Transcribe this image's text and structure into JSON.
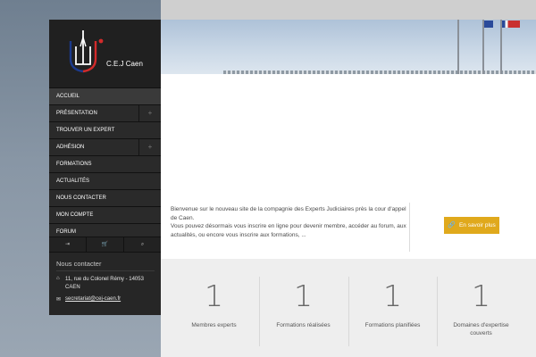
{
  "brand": {
    "name": "C.E.J Caen",
    "colors": {
      "blue": "#1b3a8c",
      "red": "#d22b2b",
      "white": "#ffffff"
    }
  },
  "nav": {
    "items": [
      {
        "label": "ACCUEIL",
        "active": true,
        "expandable": false
      },
      {
        "label": "PRÉSENTATION",
        "active": false,
        "expandable": true
      },
      {
        "label": "TROUVER UN EXPERT",
        "active": false,
        "expandable": false
      },
      {
        "label": "ADHÉSION",
        "active": false,
        "expandable": true
      },
      {
        "label": "FORMATIONS",
        "active": false,
        "expandable": false
      },
      {
        "label": "ACTUALITÉS",
        "active": false,
        "expandable": false
      },
      {
        "label": "NOUS CONTACTER",
        "active": false,
        "expandable": false
      },
      {
        "label": "MON COMPTE",
        "active": false,
        "expandable": false
      },
      {
        "label": "FORUM",
        "active": false,
        "expandable": false
      }
    ],
    "expand_symbol": "+"
  },
  "tools": [
    {
      "icon": "login-icon",
      "glyph": "⇥"
    },
    {
      "icon": "cart-icon",
      "glyph": "🛒"
    },
    {
      "icon": "search-icon",
      "glyph": "⌕"
    }
  ],
  "contact": {
    "title": "Nous contacter",
    "home_glyph": "⌂",
    "mail_glyph": "✉",
    "address": "11, rue du Colonel Rémy - 14053 CAEN",
    "email": "secretariat@cej-caen.fr"
  },
  "intro": {
    "paragraph1": "Bienvenue sur le nouveau site de la compagnie des Experts Judiciaires près la cour d'appel de Caen.",
    "paragraph2": "Vous pouvez désormais vous inscrire en ligne pour devenir membre, accéder au forum, aux actualités, ou encore vous inscrire aux formations, ...",
    "button_label": "En savoir plus",
    "button_icon": "🔗",
    "accent": "#e0a91c"
  },
  "stats": [
    {
      "value": "1",
      "label": "Membres experts"
    },
    {
      "value": "1",
      "label": "Formations réalisées"
    },
    {
      "value": "1",
      "label": "Formations planifiées"
    },
    {
      "value": "1",
      "label": "Domaines d'expertise couverts"
    }
  ]
}
